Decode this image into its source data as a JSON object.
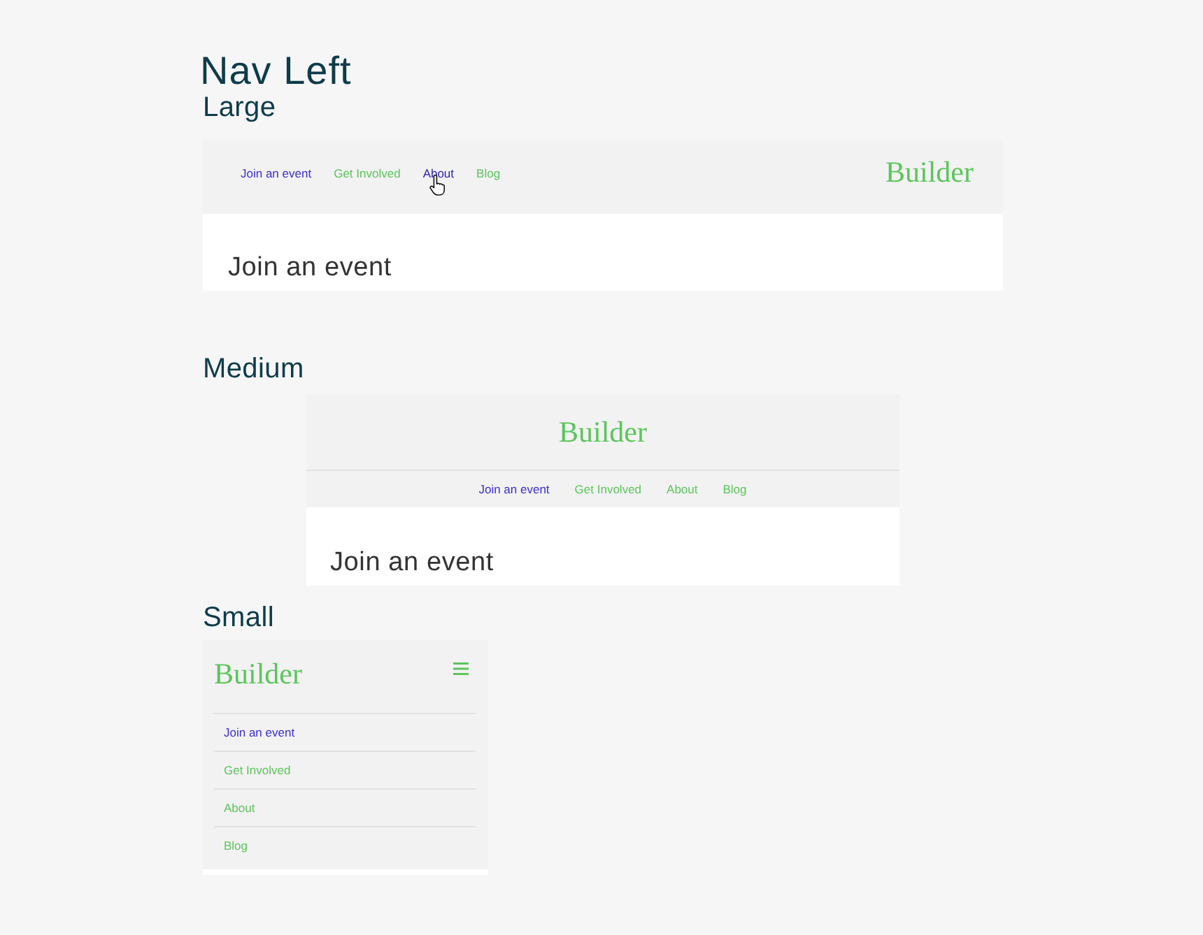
{
  "title": "Nav Left",
  "variants": [
    {
      "kind": "large",
      "heading": "Large",
      "brand": "Builder",
      "nav": [
        {
          "label": "Join an event",
          "selected": true,
          "hovered": false
        },
        {
          "label": "Get Involved",
          "selected": false,
          "hovered": false
        },
        {
          "label": "About",
          "selected": false,
          "hovered": true
        },
        {
          "label": "Blog",
          "selected": false,
          "hovered": false
        }
      ],
      "content_heading": "Join an event"
    },
    {
      "kind": "medium",
      "heading": "Medium",
      "brand": "Builder",
      "nav": [
        {
          "label": "Join an event",
          "selected": true,
          "hovered": false
        },
        {
          "label": "Get Involved",
          "selected": false,
          "hovered": false
        },
        {
          "label": "About",
          "selected": false,
          "hovered": false
        },
        {
          "label": "Blog",
          "selected": false,
          "hovered": false
        }
      ],
      "content_heading": "Join an event"
    },
    {
      "kind": "small",
      "heading": "Small",
      "brand": "Builder",
      "menu_open": true,
      "nav": [
        {
          "label": "Join an event",
          "selected": true,
          "hovered": false
        },
        {
          "label": "Get Involved",
          "selected": false,
          "hovered": false
        },
        {
          "label": "About",
          "selected": false,
          "hovered": false
        },
        {
          "label": "Blog",
          "selected": false,
          "hovered": false
        }
      ]
    }
  ]
}
